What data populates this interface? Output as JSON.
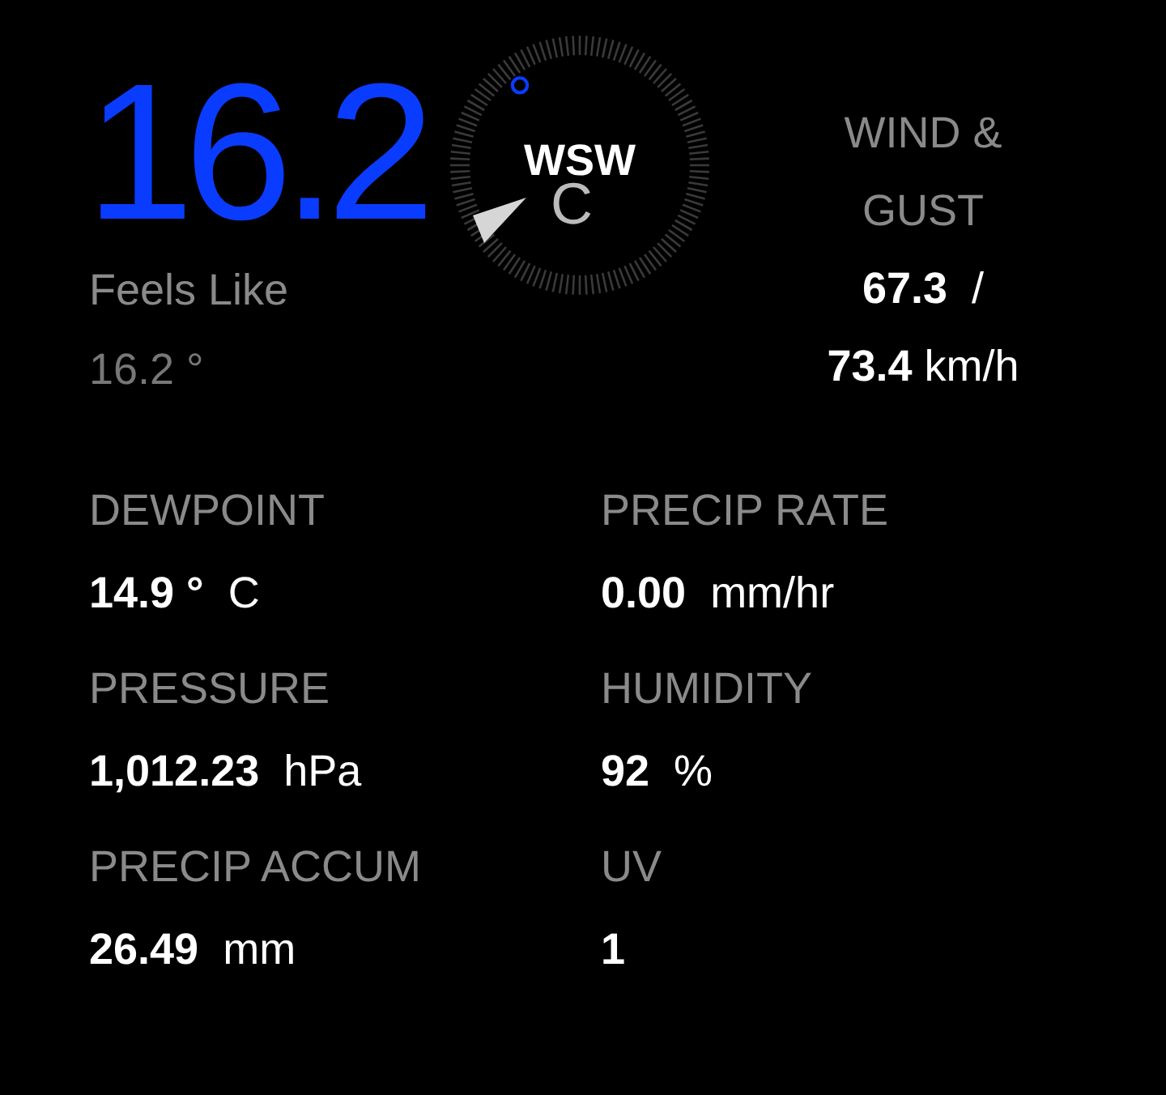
{
  "temperature": {
    "value": "16.2",
    "degree": "°",
    "unit": "C"
  },
  "feels_like": {
    "label": "Feels Like",
    "value": "16.2 °"
  },
  "compass": {
    "direction": "WSW"
  },
  "wind": {
    "label_lines": [
      "WIND &",
      "GUST"
    ],
    "speed": "67.3",
    "separator": "/",
    "gust": "73.4",
    "unit": "km/h"
  },
  "stats": [
    {
      "label": "DEWPOINT",
      "value": "14.9 °",
      "unit": "C"
    },
    {
      "label": "PRECIP RATE",
      "value": "0.00",
      "unit": "mm/hr"
    },
    {
      "label": "PRESSURE",
      "value": "1,012.23",
      "unit": "hPa"
    },
    {
      "label": "HUMIDITY",
      "value": "92",
      "unit": "%"
    },
    {
      "label": "PRECIP ACCUM",
      "value": "26.49",
      "unit": "mm"
    },
    {
      "label": "UV",
      "value": "1"
    }
  ]
}
